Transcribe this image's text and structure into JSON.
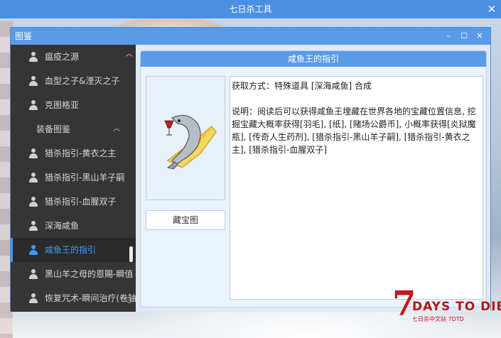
{
  "app": {
    "title": "七日杀工具",
    "close": "✕"
  },
  "window": {
    "title": "图鉴",
    "controls": [
      "–",
      "☐",
      "✕"
    ]
  },
  "sidebar": {
    "items": [
      {
        "label": "瘟疫之源",
        "type": "item"
      },
      {
        "label": "血型之子&湮灭之子",
        "type": "item"
      },
      {
        "label": "克图格亚",
        "type": "item"
      },
      {
        "label": "装备图鉴",
        "type": "header"
      },
      {
        "label": "猎杀指引-黄衣之主",
        "type": "item"
      },
      {
        "label": "猎杀指引-黑山羊子嗣",
        "type": "item"
      },
      {
        "label": "猎杀指引-血腥双子",
        "type": "item"
      },
      {
        "label": "深海咸鱼",
        "type": "item"
      },
      {
        "label": "咸鱼王的指引",
        "type": "item",
        "selected": true
      },
      {
        "label": "黑山羊之母的恩賜-瞬值",
        "type": "item"
      },
      {
        "label": "恢复咒术-瞬间治疗(卷轴",
        "type": "item"
      }
    ]
  },
  "detail": {
    "title": "咸鱼王的指引",
    "map_button": "藏宝图",
    "acquire": "获取方式：特殊道具 [深海咸鱼] 合成",
    "description": "说明：阅读后可以获得咸鱼王埋藏在世界各地的宝藏位置信息, 挖掘宝藏大概率获得[羽毛], [纸], [赌场公爵币], 小概率获得[炎狱魔瓶], [传奇人生药剂], [猎杀指引-黑山羊子嗣], [猎杀指引-黄衣之主], [猎杀指引-血腥双子]"
  },
  "logo": {
    "text": "DAYS TO DIE",
    "number": "7",
    "sub": "七日杀中文站 7DTD"
  },
  "colors": {
    "accent": "#5a9be8",
    "selected": "#3e9bf5",
    "sidebar_bg": "#353535"
  }
}
